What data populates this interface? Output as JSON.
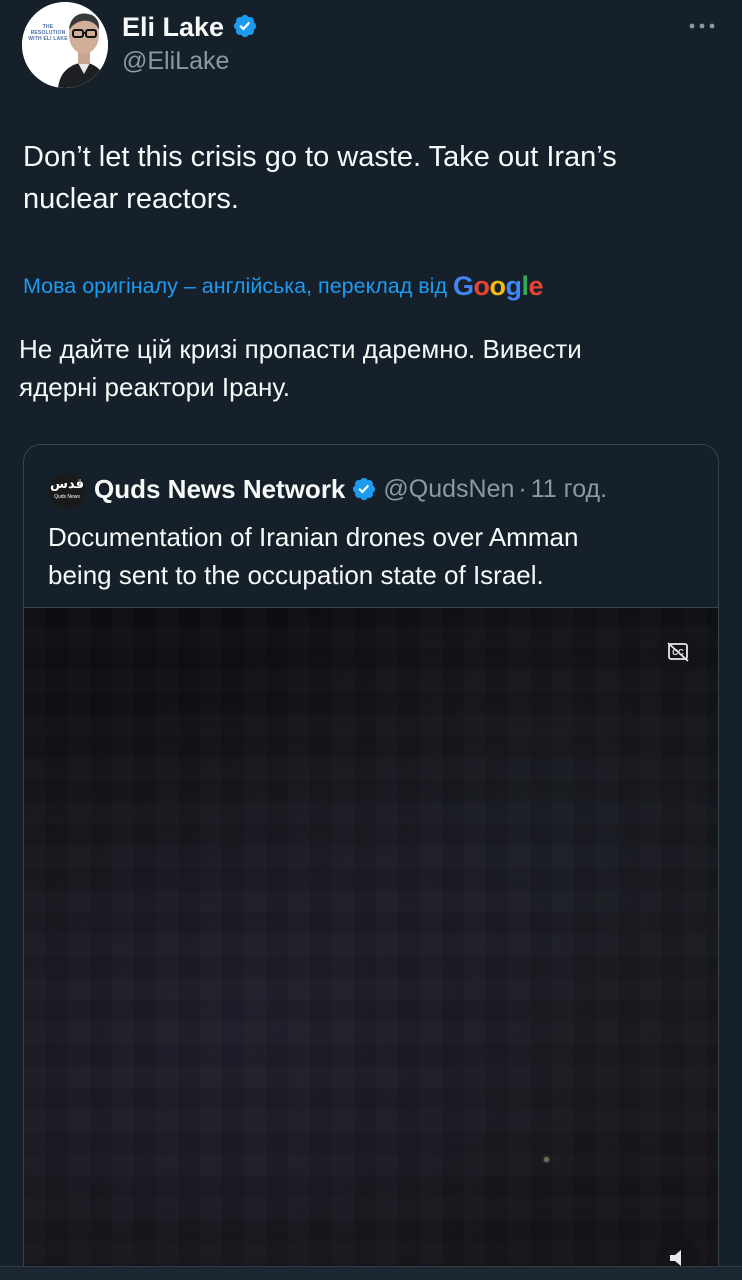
{
  "author": {
    "name": "Eli Lake",
    "handle": "@EliLake",
    "avatar_text": "THE RESOLUTION WITH ELI LAKE",
    "verified": true
  },
  "tweet": {
    "text": "Don’t let this crisis go to waste. Take out Iran’s\nnuclear reactors.",
    "translation_label": "Мова оригіналу – англійська, переклад від",
    "translation_provider": "Google",
    "translated_text": "Не дайте цій кризі пропасти даремно. Вивести\nядерні реактори Ірану."
  },
  "quote": {
    "name": "Quds News Network",
    "handle": "@QudsNen",
    "separator": "·",
    "time": "11 год.",
    "avatar_arabic": "قدس",
    "avatar_latin": "Quds News",
    "text": "Documentation of Iranian drones over Amman\nbeing sent to the occupation state of Israel.",
    "verified": true
  },
  "icons": {
    "verified": "verified-badge-icon",
    "more": "more-dots-icon",
    "captions": "captions-off-icon",
    "volume": "volume-icon"
  },
  "colors": {
    "background": "#15202b",
    "text_primary": "#f7f9f9",
    "text_secondary": "#8b98a5",
    "accent": "#1d9bf0",
    "border": "#38444d"
  }
}
